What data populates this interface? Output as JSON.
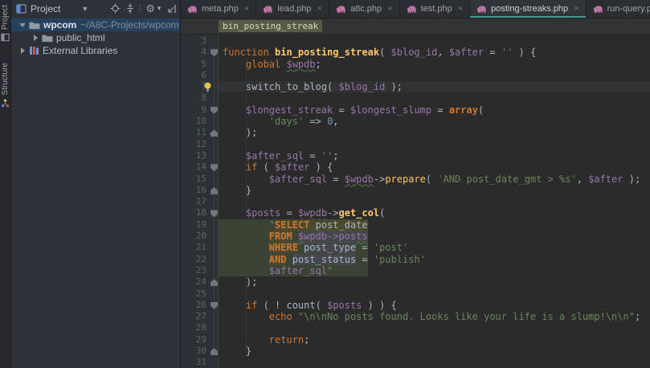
{
  "tool_stripe": {
    "project_label": "Project",
    "structure_label": "Structure"
  },
  "project_panel": {
    "title": "Project",
    "toolbar_icons": [
      "locate-icon",
      "collapse-all-icon",
      "settings-icon",
      "hide-panel-icon"
    ],
    "tree": [
      {
        "name": "wpcom",
        "path": "~/A8C-Projects/wpcom",
        "icon": "folder",
        "expanded": true,
        "selected": true
      },
      {
        "name": "public_html",
        "icon": "folder",
        "expanded": false
      },
      {
        "name": "External Libraries",
        "icon": "library",
        "expanded": false
      }
    ]
  },
  "editor_tabs": {
    "close_glyph": "×",
    "tabs": [
      {
        "label": "meta.php",
        "active": false
      },
      {
        "label": "lead.php",
        "active": false
      },
      {
        "label": "a8c.php",
        "active": false
      },
      {
        "label": "test.php",
        "active": false
      },
      {
        "label": "posting-streaks.php",
        "active": true
      },
      {
        "label": "run-query.php",
        "active": false
      }
    ]
  },
  "breadcrumb": {
    "label": "bin_posting_streak"
  },
  "colors": {
    "accent_teal": "#4A9793",
    "keyword_orange": "#CC7832",
    "function_yellow": "#FFC66D",
    "variable_purple": "#9876AA",
    "string_green": "#6A8759",
    "number_blue": "#6897BB",
    "plain_gray": "#A9B7C6",
    "selection_blue": "#26415e",
    "sql_band_green": "#3a4334",
    "sql_token_khaki": "#4a4930",
    "editor_bg": "#2b2b2b"
  },
  "editor": {
    "lines": [
      {
        "num": 3,
        "tokens": []
      },
      {
        "num": 4,
        "fold": "open",
        "tokens": [
          [
            "function ",
            "kw"
          ],
          [
            "bin_posting_streak",
            "fnb"
          ],
          [
            "( ",
            "pl"
          ],
          [
            "$blog_id",
            "var"
          ],
          [
            ", ",
            "pl"
          ],
          [
            "$after",
            "var"
          ],
          [
            " = ",
            "pl"
          ],
          [
            "''",
            "str"
          ],
          [
            " ) {",
            "pl"
          ]
        ]
      },
      {
        "num": 5,
        "tokens": [
          [
            "    ",
            "pl"
          ],
          [
            "global ",
            "kw"
          ],
          [
            "$wpdb",
            "varw"
          ],
          [
            ";",
            "pl"
          ]
        ]
      },
      {
        "num": 6,
        "tokens": []
      },
      {
        "num": 7,
        "caret": true,
        "bulb": true,
        "tokens": [
          [
            "    switch_to_blog( ",
            "pl"
          ],
          [
            "$blog_id",
            "var"
          ],
          [
            " );",
            "pl"
          ]
        ]
      },
      {
        "num": 8,
        "tokens": []
      },
      {
        "num": 9,
        "fold": "open",
        "tokens": [
          [
            "    ",
            "pl"
          ],
          [
            "$longest_streak",
            "var"
          ],
          [
            " = ",
            "pl"
          ],
          [
            "$longest_slump",
            "var"
          ],
          [
            " = ",
            "pl"
          ],
          [
            "array",
            "kwb"
          ],
          [
            "(",
            "pl"
          ]
        ]
      },
      {
        "num": 10,
        "tokens": [
          [
            "        ",
            "pl"
          ],
          [
            "'days'",
            "str"
          ],
          [
            " => ",
            "pl"
          ],
          [
            "0",
            "num"
          ],
          [
            ",",
            "pl"
          ]
        ]
      },
      {
        "num": 11,
        "fold": "close",
        "tokens": [
          [
            "    );",
            "pl"
          ]
        ]
      },
      {
        "num": 12,
        "tokens": []
      },
      {
        "num": 13,
        "tokens": [
          [
            "    ",
            "pl"
          ],
          [
            "$after_sql",
            "var"
          ],
          [
            " = ",
            "pl"
          ],
          [
            "''",
            "str"
          ],
          [
            ";",
            "pl"
          ]
        ]
      },
      {
        "num": 14,
        "fold": "open",
        "tokens": [
          [
            "    ",
            "pl"
          ],
          [
            "if",
            "kw"
          ],
          [
            " ( ",
            "pl"
          ],
          [
            "$after",
            "var"
          ],
          [
            " ) {",
            "pl"
          ]
        ]
      },
      {
        "num": 15,
        "tokens": [
          [
            "        ",
            "pl"
          ],
          [
            "$after_sql",
            "var"
          ],
          [
            " = ",
            "pl"
          ],
          [
            "$wpdb",
            "varw"
          ],
          [
            "->",
            "pl"
          ],
          [
            "prepare",
            "fn"
          ],
          [
            "( ",
            "pl"
          ],
          [
            "'AND post_date_gmt > %s'",
            "str"
          ],
          [
            ", ",
            "pl"
          ],
          [
            "$after",
            "var"
          ],
          [
            " );",
            "pl"
          ]
        ]
      },
      {
        "num": 16,
        "fold": "close",
        "tokens": [
          [
            "    }",
            "pl"
          ]
        ]
      },
      {
        "num": 17,
        "tokens": []
      },
      {
        "num": 18,
        "fold": "open",
        "tokens": [
          [
            "    ",
            "pl"
          ],
          [
            "$posts",
            "var"
          ],
          [
            " = ",
            "pl"
          ],
          [
            "$wpdb",
            "varw"
          ],
          [
            "->",
            "pl"
          ],
          [
            "get_col",
            "fnb"
          ],
          [
            "(",
            "pl"
          ]
        ]
      },
      {
        "num": 19,
        "band": true,
        "tokens": [
          [
            "        ",
            "pl"
          ],
          [
            "\"",
            "str"
          ],
          [
            "SELECT",
            "sqlkw"
          ],
          [
            " post_date",
            "sqlcol"
          ]
        ]
      },
      {
        "num": 20,
        "band": true,
        "tokens": [
          [
            "        ",
            "pl"
          ],
          [
            "FROM",
            "sqlkw"
          ],
          [
            " ",
            "pl"
          ],
          [
            "$wpdb->posts",
            "sqlvar"
          ]
        ]
      },
      {
        "num": 21,
        "band": true,
        "tokens": [
          [
            "        ",
            "pl"
          ],
          [
            "WHERE",
            "sqlkw"
          ],
          [
            " ",
            "pl"
          ],
          [
            "post_type",
            "sqlid"
          ],
          [
            " = ",
            "pl"
          ],
          [
            "'post'",
            "str"
          ]
        ]
      },
      {
        "num": 22,
        "band": true,
        "tokens": [
          [
            "        ",
            "pl"
          ],
          [
            "AND",
            "sqlkw"
          ],
          [
            " ",
            "pl"
          ],
          [
            "post_status",
            "sqlid"
          ],
          [
            " = ",
            "pl"
          ],
          [
            "'publish'",
            "str"
          ]
        ]
      },
      {
        "num": 23,
        "band": true,
        "tokens": [
          [
            "        ",
            "pl"
          ],
          [
            "$after_sql",
            "var"
          ],
          [
            "\"",
            "str"
          ]
        ]
      },
      {
        "num": 24,
        "fold": "close",
        "tokens": [
          [
            "    );",
            "pl"
          ]
        ]
      },
      {
        "num": 25,
        "tokens": []
      },
      {
        "num": 26,
        "fold": "open",
        "tokens": [
          [
            "    ",
            "pl"
          ],
          [
            "if",
            "kw"
          ],
          [
            " ( ! count( ",
            "pl"
          ],
          [
            "$posts",
            "var"
          ],
          [
            " ) ) {",
            "pl"
          ]
        ]
      },
      {
        "num": 27,
        "tokens": [
          [
            "        ",
            "pl"
          ],
          [
            "echo ",
            "kw"
          ],
          [
            "\"\\n\\nNo posts found. Looks like your life is a slump!\\n\\n\"",
            "str"
          ],
          [
            ";",
            "pl"
          ]
        ]
      },
      {
        "num": 28,
        "tokens": []
      },
      {
        "num": 29,
        "tokens": [
          [
            "        ",
            "pl"
          ],
          [
            "return",
            "kw"
          ],
          [
            ";",
            "pl"
          ]
        ]
      },
      {
        "num": 30,
        "fold": "close",
        "tokens": [
          [
            "    }",
            "pl"
          ]
        ]
      },
      {
        "num": 31,
        "tokens": []
      }
    ]
  }
}
